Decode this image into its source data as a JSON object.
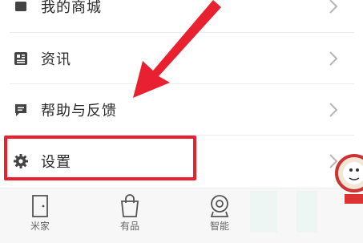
{
  "menu": {
    "items": [
      {
        "label": "我的商城",
        "icon": "store-icon"
      },
      {
        "label": "资讯",
        "icon": "news-icon"
      },
      {
        "label": "帮助与反馈",
        "icon": "feedback-icon"
      },
      {
        "label": "设置",
        "icon": "settings-gear-icon",
        "highlighted": true
      }
    ]
  },
  "tabbar": {
    "tabs": [
      {
        "label": "米家",
        "icon": "home-door-icon"
      },
      {
        "label": "有品",
        "icon": "shopping-bag-icon"
      },
      {
        "label": "智能",
        "icon": "smart-camera-icon"
      }
    ]
  },
  "colors": {
    "annotation": "#e8202f",
    "divider": "#ececec",
    "tabbar_bg": "#f7f7f7",
    "text": "#2b2b2b"
  }
}
